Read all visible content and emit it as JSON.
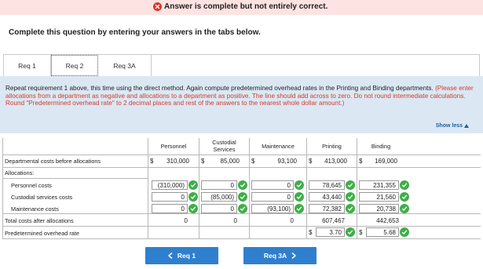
{
  "banner": {
    "text": "Answer is complete but not entirely correct."
  },
  "instructions": "Complete this question by entering your answers in the tabs below.",
  "tabs": [
    {
      "label": "Req 1"
    },
    {
      "label": "Req 2"
    },
    {
      "label": "Req 3A"
    }
  ],
  "panel": {
    "text_plain": "Repeat requirement 1 above, this time using the direct method. Again compute predetermined overhead rates in the Printing and Binding departments. ",
    "text_red": "(Please enter allocations from a department as negative and allocations to a department as positive. The line should add across to zero. Do not round intermediate calculations. Round \"Predetermined overhead rate\" to 2 decimal places and rest of the answers to the nearest whole dollar amount.)",
    "show_less": "Show less"
  },
  "table": {
    "headers": {
      "personnel": "Personnel",
      "custodial_1": "Custodial",
      "custodial_2": "Services",
      "maintenance": "Maintenance",
      "printing": "Printing",
      "binding": "Binding"
    },
    "rows": {
      "dept_costs": {
        "label": "Departmental costs before allocations",
        "personnel_sym": "$",
        "personnel": "310,000",
        "custodial_sym": "$",
        "custodial": "85,000",
        "maintenance_sym": "$",
        "maintenance": "93,100",
        "printing_sym": "$",
        "printing": "413,000",
        "binding_sym": "$",
        "binding": "169,000"
      },
      "allocations": {
        "label": "Allocations:"
      },
      "personnel_costs": {
        "label": "Personnel costs",
        "personnel": "(310,000)",
        "custodial": "0",
        "maintenance": "0",
        "printing": "78,645",
        "binding": "231,355"
      },
      "custodial_costs": {
        "label": "Custodial services costs",
        "personnel": "0",
        "custodial": "(85,000)",
        "maintenance": "0",
        "printing": "43,440",
        "binding": "21,560"
      },
      "maintenance_costs": {
        "label": "Maintenance costs",
        "personnel": "0",
        "custodial": "0",
        "maintenance": "(93,100)",
        "printing": "72,382",
        "binding": "20,738"
      },
      "total": {
        "label": "Total costs after allocations",
        "personnel": "0",
        "custodial": "0",
        "maintenance": "0",
        "printing": "607,467",
        "binding": "442,653"
      },
      "rate": {
        "label": "Predetermined overhead rate",
        "printing_sym": "$",
        "printing": "3.70",
        "binding_sym": "$",
        "binding": "5.68"
      }
    }
  },
  "buttons": {
    "prev": "Req 1",
    "next": "Req 3A"
  },
  "colors": {
    "check": "#3fae49",
    "error": "#d9342b",
    "button": "#2f7fcf",
    "panel": "#dbe8f4"
  }
}
